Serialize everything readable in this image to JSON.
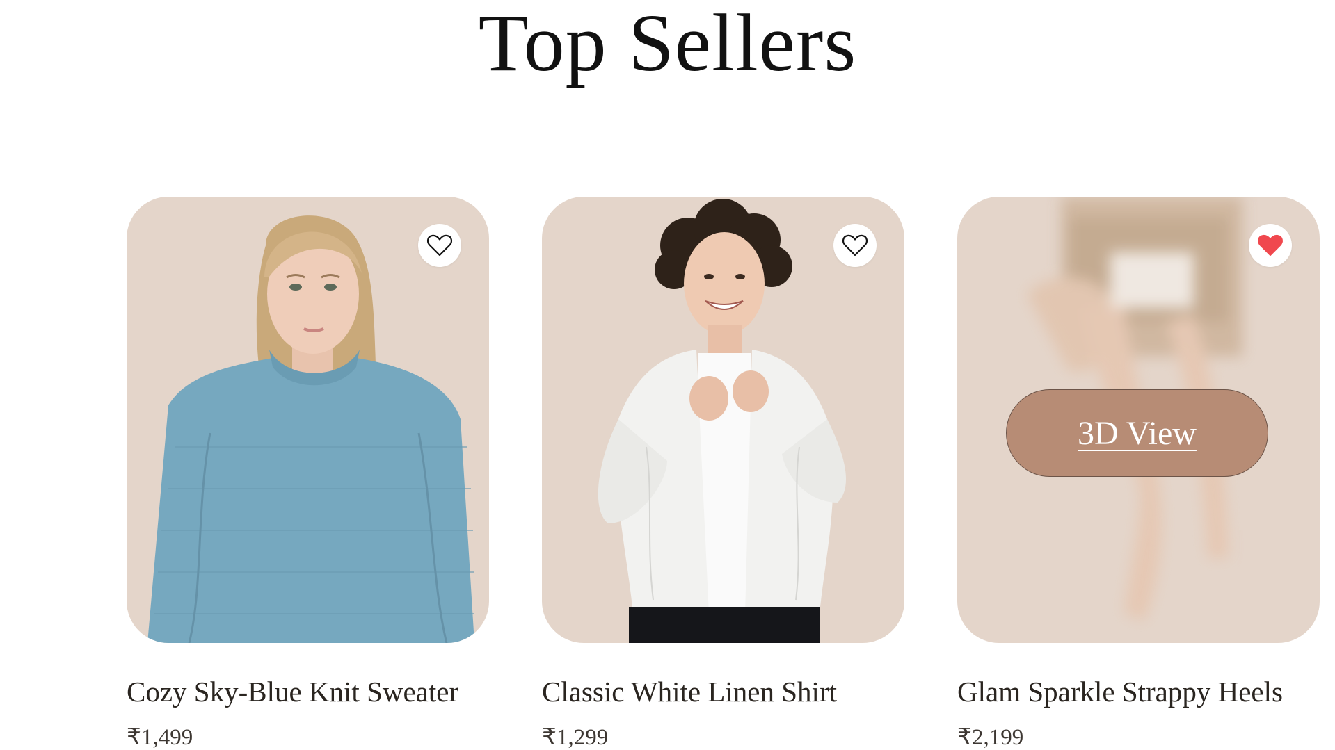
{
  "section": {
    "title": "Top Sellers"
  },
  "products": [
    {
      "name": "Cozy Sky-Blue Knit Sweater",
      "price": "₹1,499",
      "wishlisted": false
    },
    {
      "name": "Classic White Linen Shirt",
      "price": "₹1,299",
      "wishlisted": false
    },
    {
      "name": "Glam Sparkle Strappy Heels",
      "price": "₹2,199",
      "wishlisted": true,
      "overlay_button": "3D View"
    }
  ],
  "colors": {
    "card_bg": "#e4d5ca",
    "button_bg": "#b78c75",
    "heart_active": "#f0484e",
    "text": "#2a2520"
  }
}
